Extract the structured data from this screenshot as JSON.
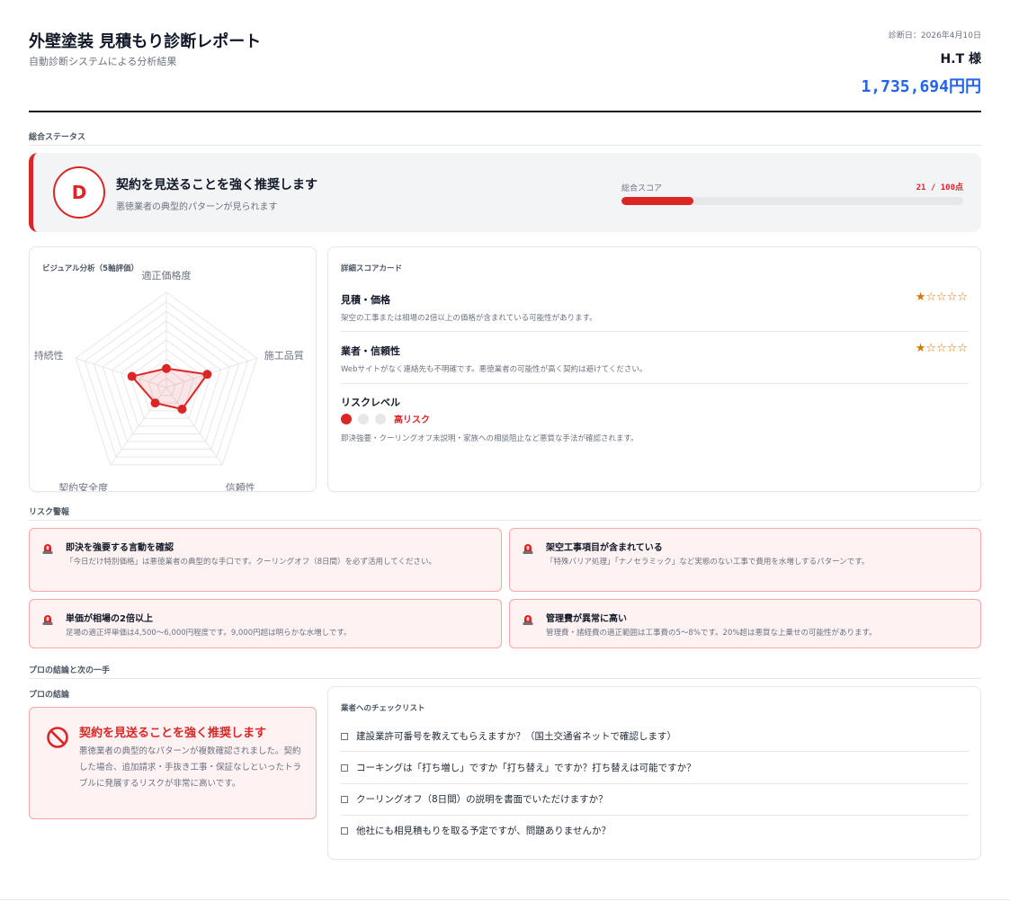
{
  "header": {
    "title": "外壁塗装 見積もり診断レポート",
    "subtitle": "自動診断システムによる分析結果",
    "date": "診断日：2026年4月10日",
    "customer": "H.T 様",
    "price": "1,735,694円円"
  },
  "overall": {
    "section_label": "総合ステータス",
    "grade": "D",
    "title": "契約を見送ることを強く推奨します",
    "subtitle": "悪徳業者の典型的パターンが見られます",
    "score_label": "総合スコア",
    "score_text": "21 / 100点",
    "score": 21,
    "score_max": 100
  },
  "radar": {
    "label": "ビジュアル分析（5軸評価）",
    "axes": [
      "適正価格度",
      "施工品質",
      "信頼性",
      "契約安全度",
      "持続性"
    ],
    "values": [
      0.2,
      0.45,
      0.28,
      0.2,
      0.38
    ],
    "color": "#dc2626"
  },
  "details": {
    "label": "詳細スコアカード",
    "items": [
      {
        "title": "見積・価格",
        "stars": "★☆☆☆☆",
        "rating": 1,
        "desc": "架空の工事または相場の2倍以上の価格が含まれている可能性があります。"
      },
      {
        "title": "業者・信頼性",
        "stars": "★☆☆☆☆",
        "rating": 1,
        "desc": "Webサイトがなく連絡先も不明確です。悪徳業者の可能性が高く契約は避けてください。"
      }
    ],
    "risk": {
      "title": "リスクレベル",
      "level_text": "高リスク",
      "level": 1,
      "desc": "即決強要・クーリングオフ未説明・家族への相談阻止など悪質な手法が確認されます。"
    }
  },
  "alerts": {
    "section_label": "リスク警報",
    "items": [
      {
        "title": "即決を強要する言動を確認",
        "desc": "「今日だけ特別価格」は悪徳業者の典型的な手口です。クーリングオフ（8日間）を必ず活用してください。"
      },
      {
        "title": "架空工事項目が含まれている",
        "desc": "「特殊バリア処理」「ナノセラミック」など実態のない工事で費用を水増しするパターンです。"
      },
      {
        "title": "単価が相場の2倍以上",
        "desc": "足場の適正坪単価は4,500〜6,000円程度です。9,000円超は明らかな水増しです。"
      },
      {
        "title": "管理費が異常に高い",
        "desc": "管理費・諸経費の適正範囲は工事費の5〜8%です。20%超は悪質な上乗せの可能性があります。"
      }
    ]
  },
  "conclusion": {
    "section_label": "プロの結論と次の一手",
    "sub_label": "プロの結論",
    "title": "契約を見送ることを強く推奨します",
    "desc": "悪徳業者の典型的なパターンが複数確認されました。契約した場合、追加請求・手抜き工事・保証なしといったトラブルに発展するリスクが非常に高いです。"
  },
  "checklist": {
    "label": "業者へのチェックリスト",
    "items": [
      "建設業許可番号を教えてもらえますか？（国土交通省ネットで確認します）",
      "コーキングは「打ち増し」ですか「打ち替え」ですか？打ち替えは可能ですか？",
      "クーリングオフ（8日間）の説明を書面でいただけますか？",
      "他社にも相見積もりを取る予定ですが、問題ありませんか？"
    ]
  },
  "colors": {
    "danger": "#dc2626",
    "accent": "#2563eb",
    "star": "#d97706"
  }
}
